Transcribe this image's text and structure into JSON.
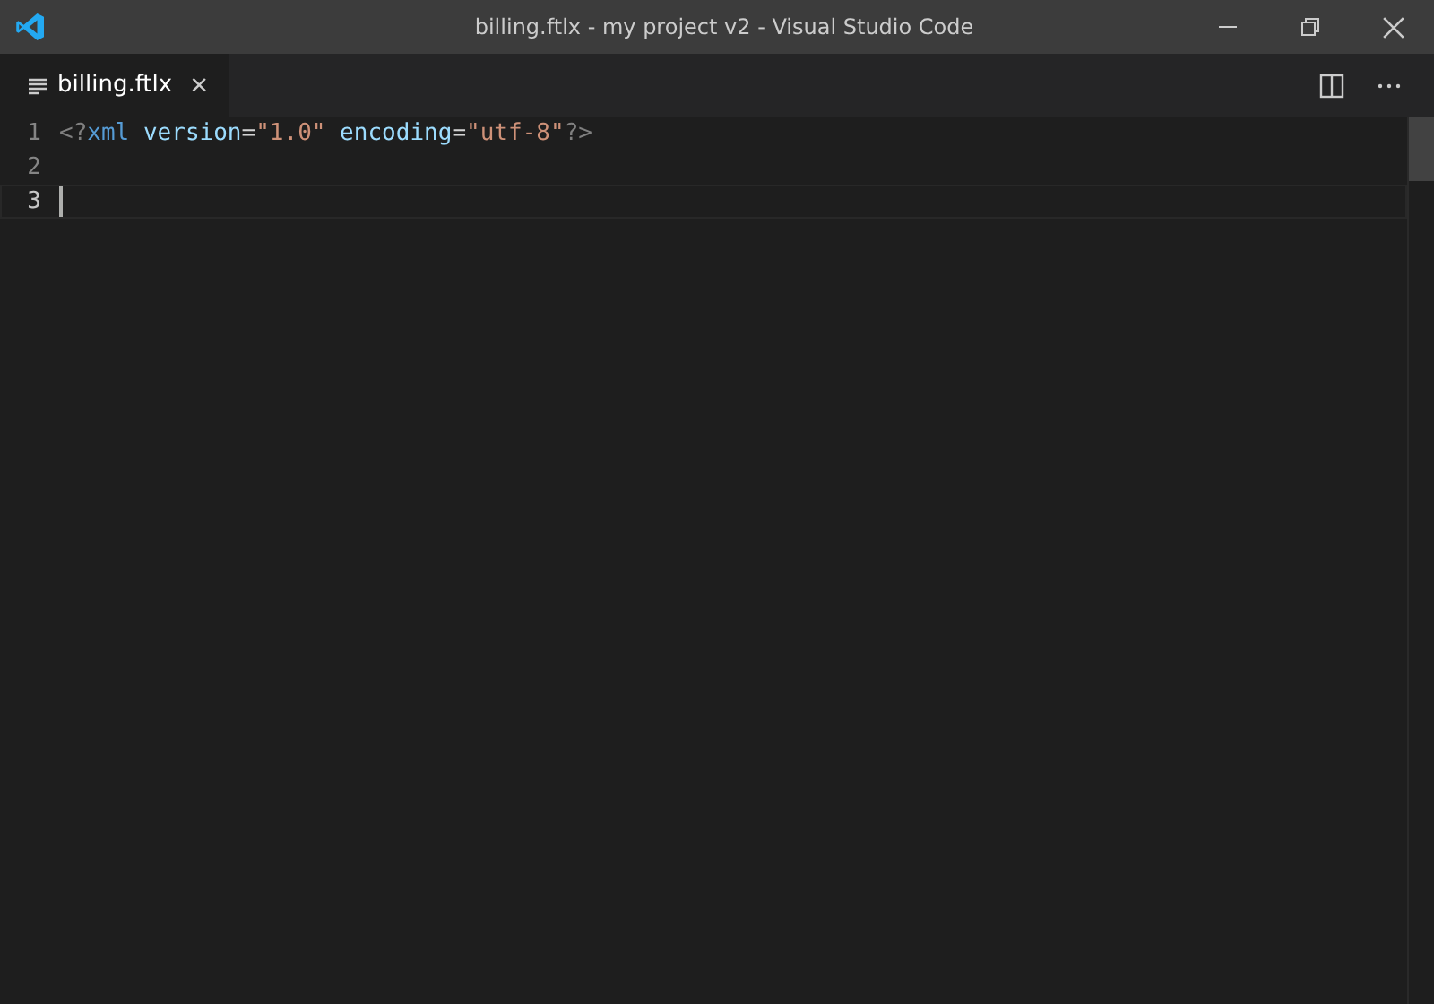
{
  "window": {
    "title": "billing.ftlx - my project v2 - Visual Studio Code"
  },
  "tabs": [
    {
      "label": "billing.ftlx",
      "close": "×",
      "selected": true
    }
  ],
  "editor": {
    "lines": [
      {
        "number": "1",
        "current": false,
        "tokens": [
          {
            "kind": "punct",
            "text": "<?"
          },
          {
            "kind": "tag",
            "text": "xml"
          },
          {
            "kind": "attr",
            "text": " version"
          },
          {
            "kind": "op",
            "text": "="
          },
          {
            "kind": "string",
            "text": "\"1.0\""
          },
          {
            "kind": "attr",
            "text": " encoding"
          },
          {
            "kind": "op",
            "text": "="
          },
          {
            "kind": "string",
            "text": "\"utf-8\""
          },
          {
            "kind": "punct",
            "text": "?>"
          }
        ]
      },
      {
        "number": "2",
        "current": false
      },
      {
        "number": "3",
        "current": true
      }
    ]
  }
}
